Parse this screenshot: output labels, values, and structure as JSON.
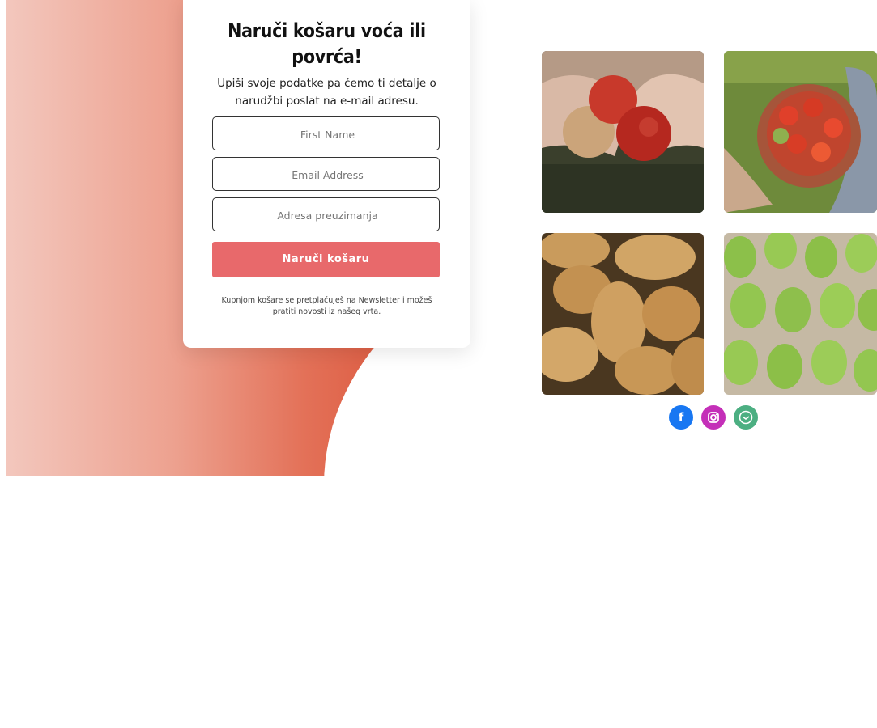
{
  "form": {
    "title_line1": "Naruči košaru voća ili",
    "title_line2": "povrća!",
    "subtitle_line1": "Upiši svoje podatke pa ćemo ti detalje o",
    "subtitle_line2": "narudžbi poslat na e-mail adresu.",
    "first_name_placeholder": "First Name",
    "email_placeholder": "Email Address",
    "address_placeholder": "Adresa preuzimanja",
    "submit_label": "Naruči košaru",
    "note_line1": "Kupnjom košare se pretplaćuješ na Newsletter i možeš",
    "note_line2": "pratiti novosti iz našeg vrta."
  },
  "gallery": {
    "images": [
      "apples-photo",
      "tomatoes-photo",
      "potatoes-photo",
      "pears-photo"
    ]
  },
  "social": {
    "facebook_glyph": "f",
    "colors": {
      "facebook": "#1877f2",
      "instagram": "#c42fb8",
      "email": "#4caf82"
    }
  },
  "colors": {
    "accent": "#e8696b"
  }
}
